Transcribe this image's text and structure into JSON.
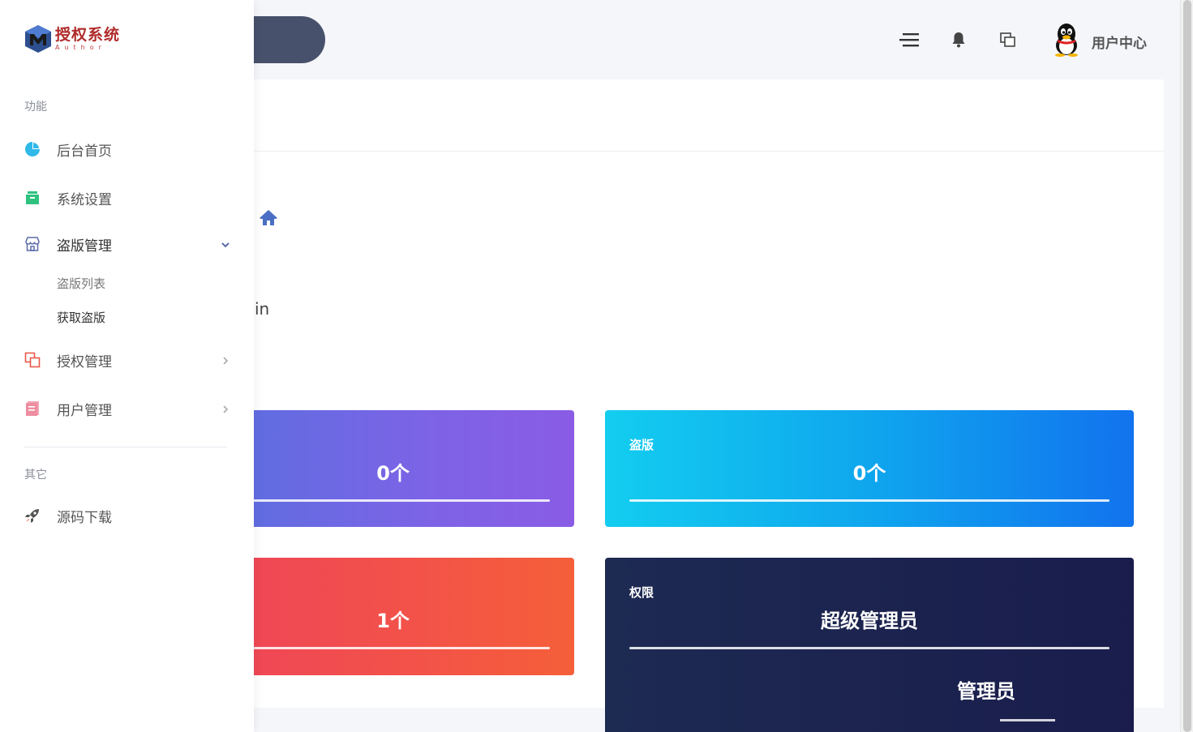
{
  "header": {
    "user_center_label": "用户中心",
    "icons": [
      "menu-icon",
      "bell-icon",
      "windows-icon",
      "qq-avatar"
    ]
  },
  "main": {
    "fragment_text": "in"
  },
  "cards": [
    {
      "label": "",
      "value": "0个",
      "color": "#7d63e6"
    },
    {
      "label": "盗版",
      "value": "0个",
      "color": "#0fa6ee"
    },
    {
      "label": "",
      "value": "1个",
      "color": "#f25249"
    },
    {
      "label": "权限",
      "value": "超级管理员",
      "color": "#1d2a52"
    }
  ],
  "ghost": {
    "text": "管理员"
  },
  "sidebar": {
    "logo_title": "授权系统",
    "logo_sub": "Author",
    "section_function": "功能",
    "items": [
      {
        "label": "后台首页",
        "icon": "pie-chart-icon"
      },
      {
        "label": "系统设置",
        "icon": "box-icon"
      },
      {
        "label": "盗版管理",
        "icon": "store-icon"
      },
      {
        "label": "授权管理",
        "icon": "copy-icon"
      },
      {
        "label": "用户管理",
        "icon": "document-icon"
      }
    ],
    "subitems": [
      {
        "label": "盗版列表"
      },
      {
        "label": "获取盗版"
      }
    ],
    "section_other": "其它",
    "other_items": [
      {
        "label": "源码下载",
        "icon": "rocket-icon"
      }
    ]
  }
}
